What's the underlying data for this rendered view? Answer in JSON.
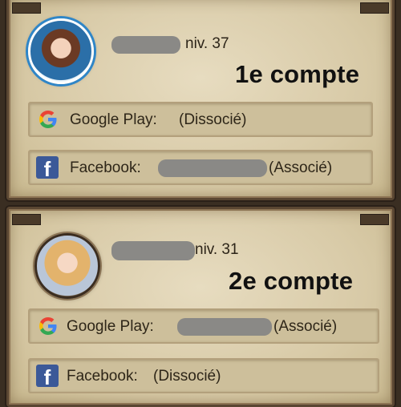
{
  "accounts": [
    {
      "level": "niv. 37",
      "label": "1e compte",
      "google_label": "Google Play:",
      "google_status": "(Dissocié)",
      "facebook_label": "Facebook:",
      "facebook_status": "(Associé)"
    },
    {
      "level": "niv. 31",
      "label": "2e compte",
      "google_label": "Google Play:",
      "google_status": "(Associé)",
      "facebook_label": "Facebook:",
      "facebook_status": "(Dissocié)"
    }
  ],
  "icons": {
    "google": "google-icon",
    "facebook": "facebook-icon",
    "facebook_glyph": "f"
  },
  "colors": {
    "facebook_blue": "#3b5998",
    "redaction_gray": "#8a8986"
  }
}
